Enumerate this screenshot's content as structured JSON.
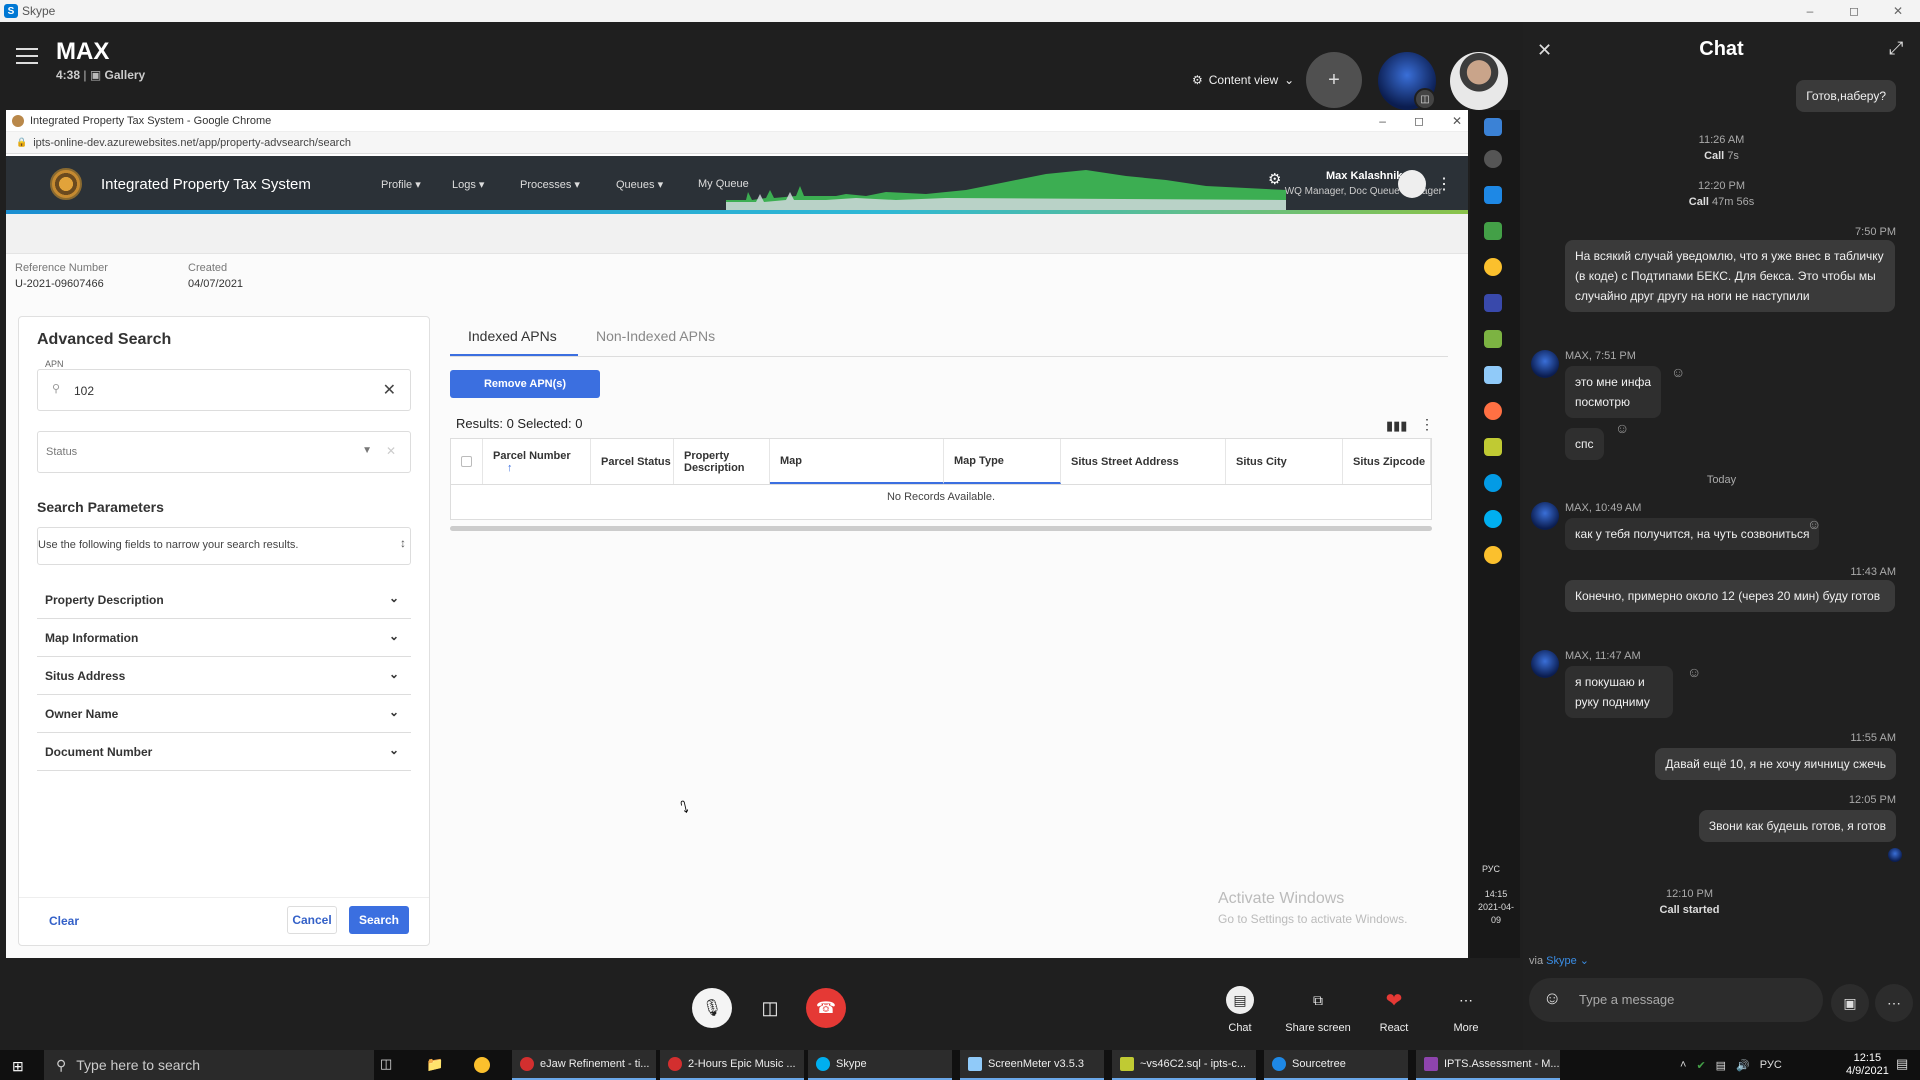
{
  "skype": {
    "window_title": "Skype",
    "call_title": "MAX",
    "call_duration": "4:38",
    "call_view": "Gallery",
    "content_view_label": "Content view"
  },
  "chrome": {
    "window_title": "Integrated Property Tax System - Google Chrome",
    "url": "ipts-online-dev.azurewebsites.net/app/property-advsearch/search"
  },
  "app": {
    "title": "Integrated Property Tax System",
    "nav": [
      "Profile",
      "Logs",
      "Processes",
      "Queues",
      "My Queue"
    ],
    "user_name": "Max Kalashnikov",
    "user_role": "WQ Manager, Doc Queue Manager",
    "reference_label": "Reference Number",
    "reference_value": "U-2021-09607466",
    "created_label": "Created",
    "created_value": "04/07/2021"
  },
  "advanced_search": {
    "title": "Advanced Search",
    "apn_label": "APN",
    "apn_value": "102",
    "status_placeholder": "Status",
    "params_title": "Search Parameters",
    "params_hint": "Use the following fields to narrow your search results.",
    "sections": [
      "Property Description",
      "Map Information",
      "Situs Address",
      "Owner Name",
      "Document Number"
    ],
    "clear_label": "Clear",
    "cancel_label": "Cancel",
    "search_label": "Search"
  },
  "results": {
    "tab_indexed": "Indexed APNs",
    "tab_nonindexed": "Non-Indexed APNs",
    "remove_label": "Remove APN(s)",
    "count_text": "Results: 0 Selected: 0",
    "columns": [
      "Parcel Number",
      "Parcel Status",
      "Property Description",
      "Map",
      "Map Type",
      "Situs Street Address",
      "Situs City",
      "Situs Zipcode"
    ],
    "empty_text": "No Records Available."
  },
  "watermark": {
    "line1": "Activate Windows",
    "line2": "Go to Settings to activate Windows."
  },
  "side_strip": {
    "lang": "РУС",
    "time": "14:15",
    "date": "2021-04-09"
  },
  "call_actions": {
    "chat": "Chat",
    "share": "Share screen",
    "react": "React",
    "more": "More"
  },
  "chat": {
    "title": "Chat",
    "first_out": "Готов,наберу?",
    "call1_time": "11:26 AM",
    "call1_label": "Call",
    "call1_dur": "7s",
    "call2_time": "12:20 PM",
    "call2_label": "Call",
    "call2_dur": "47m 56s",
    "t1": "7:50 PM",
    "msg1": "На всякий случай уведомлю, что я уже внес в табличку (в коде) с Подтипами БЕКС. Для бекса. Это чтобы мы случайно друг другу на ноги не наступили",
    "sender1": "MAX, 7:51 PM",
    "msg2": "это мне инфа посмотрю",
    "msg3": "спс",
    "today": "Today",
    "sender2": "MAX, 10:49 AM",
    "msg4": "как у тебя получится, на чуть созвониться",
    "t2": "11:43 AM",
    "msg5": "Конечно, примерно около 12 (через 20 мин) буду готов",
    "sender3": "MAX, 11:47 AM",
    "msg6": "я покушаю и руку подниму",
    "t3": "11:55 AM",
    "msg7": "Давай ещё 10, я не хочу яичницу сжечь",
    "t4": "12:05 PM",
    "msg8": "Звони как будешь готов, я готов",
    "t5": "12:10 PM",
    "call_started": "Call started",
    "via": "via",
    "via_skype": "Skype",
    "input_placeholder": "Type a message"
  },
  "taskbar": {
    "search_placeholder": "Type here to search",
    "apps": [
      "eJaw Refinement - ti...",
      "2-Hours Epic Music ...",
      "Skype",
      "ScreenMeter v3.5.3",
      "~vs46C2.sql - ipts-c...",
      "Sourcetree",
      "IPTS.Assessment - M..."
    ],
    "lang": "РУС",
    "time": "12:15",
    "date": "4/9/2021"
  }
}
